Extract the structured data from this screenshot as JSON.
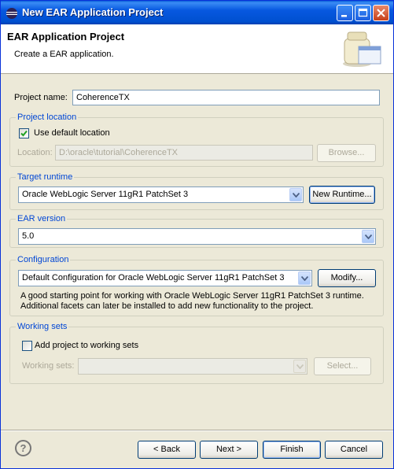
{
  "window": {
    "title": "New EAR Application Project"
  },
  "banner": {
    "title": "EAR Application Project",
    "description": "Create a EAR application."
  },
  "project_name": {
    "label": "Project name:",
    "value": "CoherenceTX"
  },
  "project_location": {
    "group_title": "Project location",
    "use_default_label": "Use default location",
    "use_default_checked": true,
    "location_label": "Location:",
    "location_value": "D:\\oracle\\tutorial\\CoherenceTX",
    "browse_label": "Browse..."
  },
  "target_runtime": {
    "group_title": "Target runtime",
    "selected": "Oracle WebLogic Server 11gR1 PatchSet 3",
    "new_runtime_label": "New Runtime..."
  },
  "ear_version": {
    "group_title": "EAR version",
    "selected": "5.0"
  },
  "configuration": {
    "group_title": "Configuration",
    "selected": "Default Configuration for Oracle WebLogic Server 11gR1 PatchSet 3",
    "modify_label": "Modify...",
    "description": "A good starting point for working with Oracle WebLogic Server 11gR1 PatchSet 3 runtime. Additional facets can later be installed to add new functionality to the project."
  },
  "working_sets": {
    "group_title": "Working sets",
    "add_label": "Add project to working sets",
    "add_checked": false,
    "sets_label": "Working sets:",
    "sets_value": "",
    "select_label": "Select..."
  },
  "footer": {
    "help_symbol": "?",
    "back_label": "< Back",
    "next_label": "Next >",
    "finish_label": "Finish",
    "cancel_label": "Cancel"
  },
  "colors": {
    "title_bar": "#0058e0",
    "group_title": "#0046d5",
    "dialog_bg": "#ece9d8"
  }
}
